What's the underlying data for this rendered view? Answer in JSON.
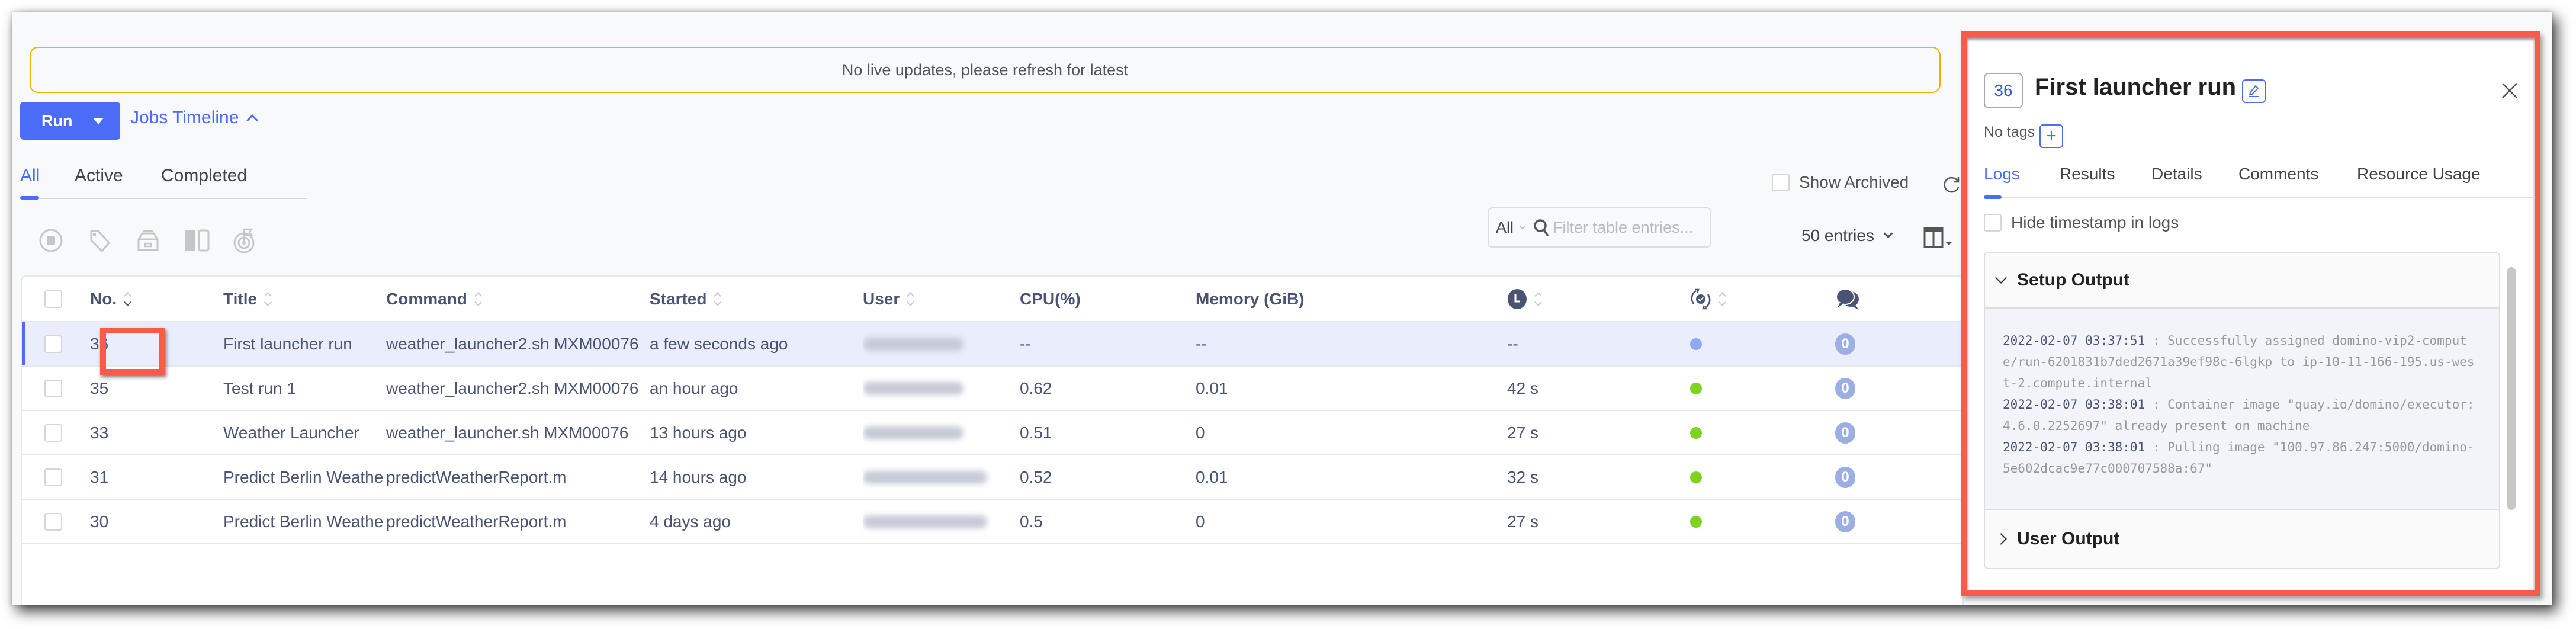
{
  "banner": {
    "text": "No live updates, please refresh for latest"
  },
  "toolbar": {
    "run_label": "Run",
    "timeline_label": "Jobs Timeline",
    "status_tabs": [
      {
        "label": "All",
        "active": true
      },
      {
        "label": "Active",
        "active": false
      },
      {
        "label": "Completed",
        "active": false
      }
    ],
    "bulk_actions": [
      "stop-icon",
      "tag-icon",
      "archive-icon",
      "compare-icon",
      "goal-icon"
    ],
    "show_archived_label": "Show Archived",
    "show_archived_checked": false,
    "filter_scope": "All",
    "filter_placeholder": "Filter table entries...",
    "filter_value": "",
    "entries_label": "50 entries"
  },
  "table": {
    "columns": {
      "no": "No.",
      "title": "Title",
      "command": "Command",
      "started": "Started",
      "user": "User",
      "cpu": "CPU(%)",
      "memory": "Memory (GiB)",
      "duration_icon": "clock-icon",
      "status_icon": "status-cycle-icon",
      "comments_icon": "comments-icon"
    },
    "rows": [
      {
        "no": "36",
        "title": "First launcher run",
        "command": "weather_launcher2.sh MXM00076",
        "started": "a few seconds ago",
        "cpu": "--",
        "memory": "--",
        "duration": "--",
        "status": "running",
        "comments": "0",
        "selected": true
      },
      {
        "no": "35",
        "title": "Test run 1",
        "command": "weather_launcher2.sh MXM00076",
        "started": "an hour ago",
        "cpu": "0.62",
        "memory": "0.01",
        "duration": "42 s",
        "status": "succeeded",
        "comments": "0",
        "selected": false
      },
      {
        "no": "33",
        "title": "Weather Launcher",
        "command": "weather_launcher.sh MXM00076",
        "started": "13 hours ago",
        "cpu": "0.51",
        "memory": "0",
        "duration": "27 s",
        "status": "succeeded",
        "comments": "0",
        "selected": false
      },
      {
        "no": "31",
        "title": "Predict Berlin Weathe",
        "command": "predictWeatherReport.m",
        "started": "14 hours ago",
        "cpu": "0.52",
        "memory": "0.01",
        "duration": "32 s",
        "status": "succeeded",
        "comments": "0",
        "selected": false
      },
      {
        "no": "30",
        "title": "Predict Berlin Weathe",
        "command": "predictWeatherReport.m",
        "started": "4 days ago",
        "cpu": "0.5",
        "memory": "0",
        "duration": "27 s",
        "status": "succeeded",
        "comments": "0",
        "selected": false
      }
    ]
  },
  "status_colors": {
    "running": "#8fa8f8",
    "succeeded": "#7ed321"
  },
  "accent_color": "#4a6cf7",
  "highlight_color": "#fa5a4a",
  "panel": {
    "run_number": "36",
    "title": "First launcher run",
    "tags_label": "No tags",
    "tabs": [
      {
        "label": "Logs",
        "active": true
      },
      {
        "label": "Results",
        "active": false
      },
      {
        "label": "Details",
        "active": false
      },
      {
        "label": "Comments",
        "active": false
      },
      {
        "label": "Resource Usage",
        "active": false
      }
    ],
    "hide_timestamp_label": "Hide timestamp in logs",
    "hide_timestamp_checked": false,
    "sections": {
      "setup": {
        "label": "Setup Output",
        "expanded": true,
        "logs": [
          {
            "ts": "2022-02-07 03:37:51",
            "msg": ": Successfully assigned domino-vip2-compute/run-6201831b7ded2671a39ef98c-6lgkp to ip-10-11-166-195.us-west-2.compute.internal"
          },
          {
            "ts": "2022-02-07 03:38:01",
            "msg": ": Container image \"quay.io/domino/executor:4.6.0.2252697\" already present on machine"
          },
          {
            "ts": "2022-02-07 03:38:01",
            "msg": ": Pulling image \"100.97.86.247:5000/domino-5e602dcac9e77c000707588a:67\""
          }
        ]
      },
      "user": {
        "label": "User Output",
        "expanded": false
      }
    }
  }
}
